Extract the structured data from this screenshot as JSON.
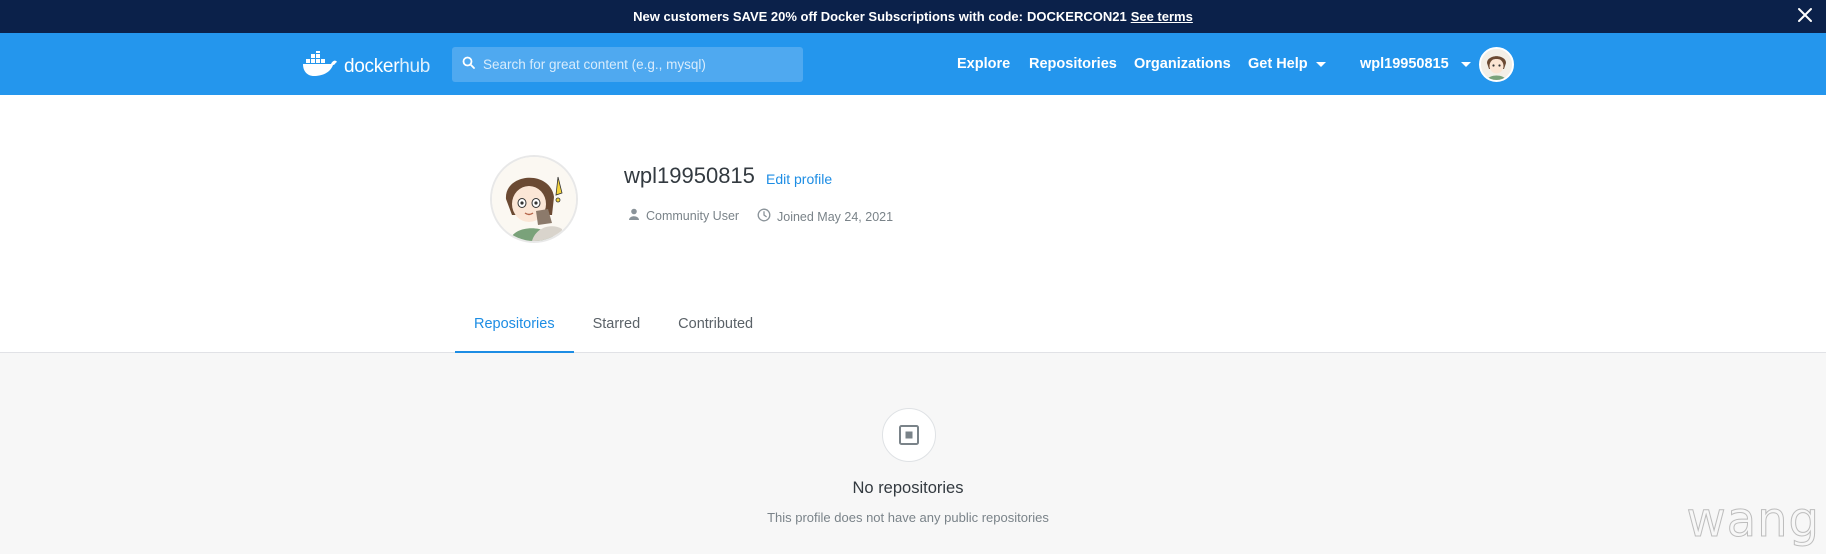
{
  "promo": {
    "text": "New customers SAVE 20% off Docker Subscriptions with code:",
    "code": "DOCKERCON21",
    "link": "See terms"
  },
  "header": {
    "logo_docker": "docker",
    "logo_hub": "hub",
    "search_placeholder": "Search for great content (e.g., mysql)",
    "nav": {
      "explore": "Explore",
      "repositories": "Repositories",
      "organizations": "Organizations",
      "get_help": "Get Help"
    },
    "username": "wpl19950815"
  },
  "profile": {
    "username": "wpl19950815",
    "edit_label": "Edit profile",
    "user_type": "Community User",
    "joined": "Joined May 24, 2021"
  },
  "tabs": [
    {
      "label": "Repositories",
      "active": true
    },
    {
      "label": "Starred",
      "active": false
    },
    {
      "label": "Contributed",
      "active": false
    }
  ],
  "empty_state": {
    "title": "No repositories",
    "subtitle": "This profile does not have any public repositories"
  },
  "watermark": "wang",
  "colors": {
    "banner_bg": "#0b214a",
    "header_bg": "#2496ed",
    "accent": "#1d8de4"
  }
}
